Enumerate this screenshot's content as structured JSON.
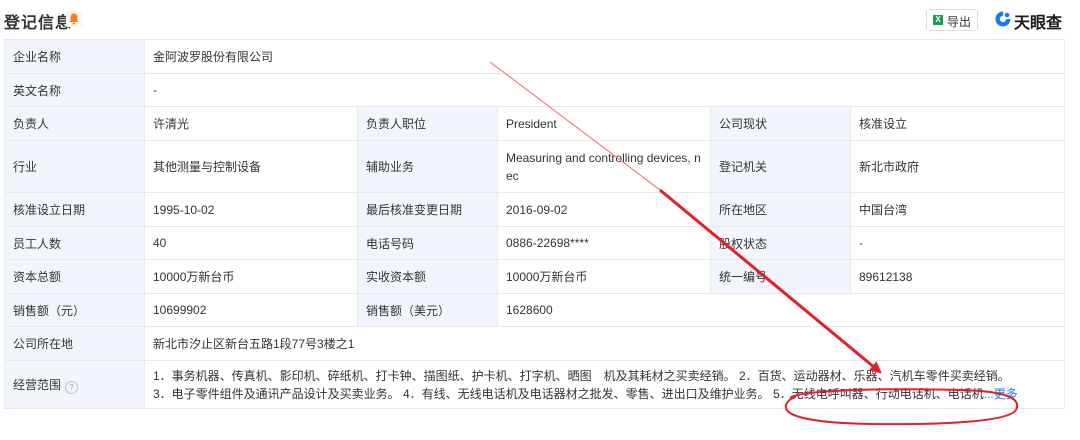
{
  "header": {
    "title": "登记信息",
    "export_label": "导出",
    "export_icon_text": "X",
    "brand_name": "天眼查"
  },
  "rows": [
    {
      "cells": [
        {
          "k": "企业名称"
        },
        {
          "v": "金阿波罗股份有限公司"
        }
      ]
    },
    {
      "cells": [
        {
          "k": "英文名称"
        },
        {
          "v": "-"
        }
      ]
    },
    {
      "cells": [
        {
          "k": "负责人"
        },
        {
          "v": "许清光"
        },
        {
          "k": "负责人职位"
        },
        {
          "v": "President"
        },
        {
          "k": "公司现状"
        },
        {
          "v": "核准设立"
        }
      ]
    },
    {
      "cells": [
        {
          "k": "行业"
        },
        {
          "v": "其他测量与控制设备"
        },
        {
          "k": "辅助业务"
        },
        {
          "v": "Measuring and controlling devices, n"
        },
        {
          "k": "登记机关"
        },
        {
          "v": "新北市政府"
        }
      ],
      "extra_line": "ec"
    },
    {
      "cells": [
        {
          "k": "核准设立日期"
        },
        {
          "v": "1995-10-02"
        },
        {
          "k": "最后核准变更日期"
        },
        {
          "v": "2016-09-02"
        },
        {
          "k": "所在地区"
        },
        {
          "v": "中国台湾"
        }
      ]
    },
    {
      "cells": [
        {
          "k": "员工人数"
        },
        {
          "v": "40"
        },
        {
          "k": "电话号码"
        },
        {
          "v": "0886-22698****"
        },
        {
          "k": "股权状态"
        },
        {
          "v": "-"
        }
      ]
    },
    {
      "cells": [
        {
          "k": "资本总额"
        },
        {
          "v": "10000万新台币"
        },
        {
          "k": "实收资本额"
        },
        {
          "v": "10000万新台币"
        },
        {
          "k": "统一编号"
        },
        {
          "v": "89612138"
        }
      ]
    },
    {
      "cells": [
        {
          "k": "销售额（元）"
        },
        {
          "v": "10699902"
        },
        {
          "k": "销售额（美元）"
        },
        {
          "v": "1628600"
        }
      ]
    },
    {
      "cells": [
        {
          "k": "公司所在地"
        },
        {
          "v": "新北市汐止区新台五路1段77号3楼之1"
        }
      ]
    }
  ],
  "scope": {
    "label": "经营范围",
    "line1": "1．事务机器、传真机、影印机、碎纸机、打卡钟、描图纸、护卡机、打字机、晒图　机及其耗材之买卖经销。 2．百货、运动器材、乐器、汽机车零件买卖经销。",
    "line2": "3．电子零件组件及通讯产品设计及买卖业务。 4．有线、无线电话机及电话器材之批发、零售、进出口及维护业务。 5．无线电呼叫器、行动电话机、电话机",
    "ellipsis": "...",
    "more": "更多"
  },
  "colors": {
    "key_bg": "#f2f6fc",
    "border": "#e4e9f2",
    "link": "#1a7fe8",
    "annotation_red": "#e0202a",
    "bell": "#ff7a1a"
  },
  "icons": [
    "bell-icon",
    "excel-icon",
    "tianyancha-logo-icon",
    "help-circle-icon"
  ]
}
